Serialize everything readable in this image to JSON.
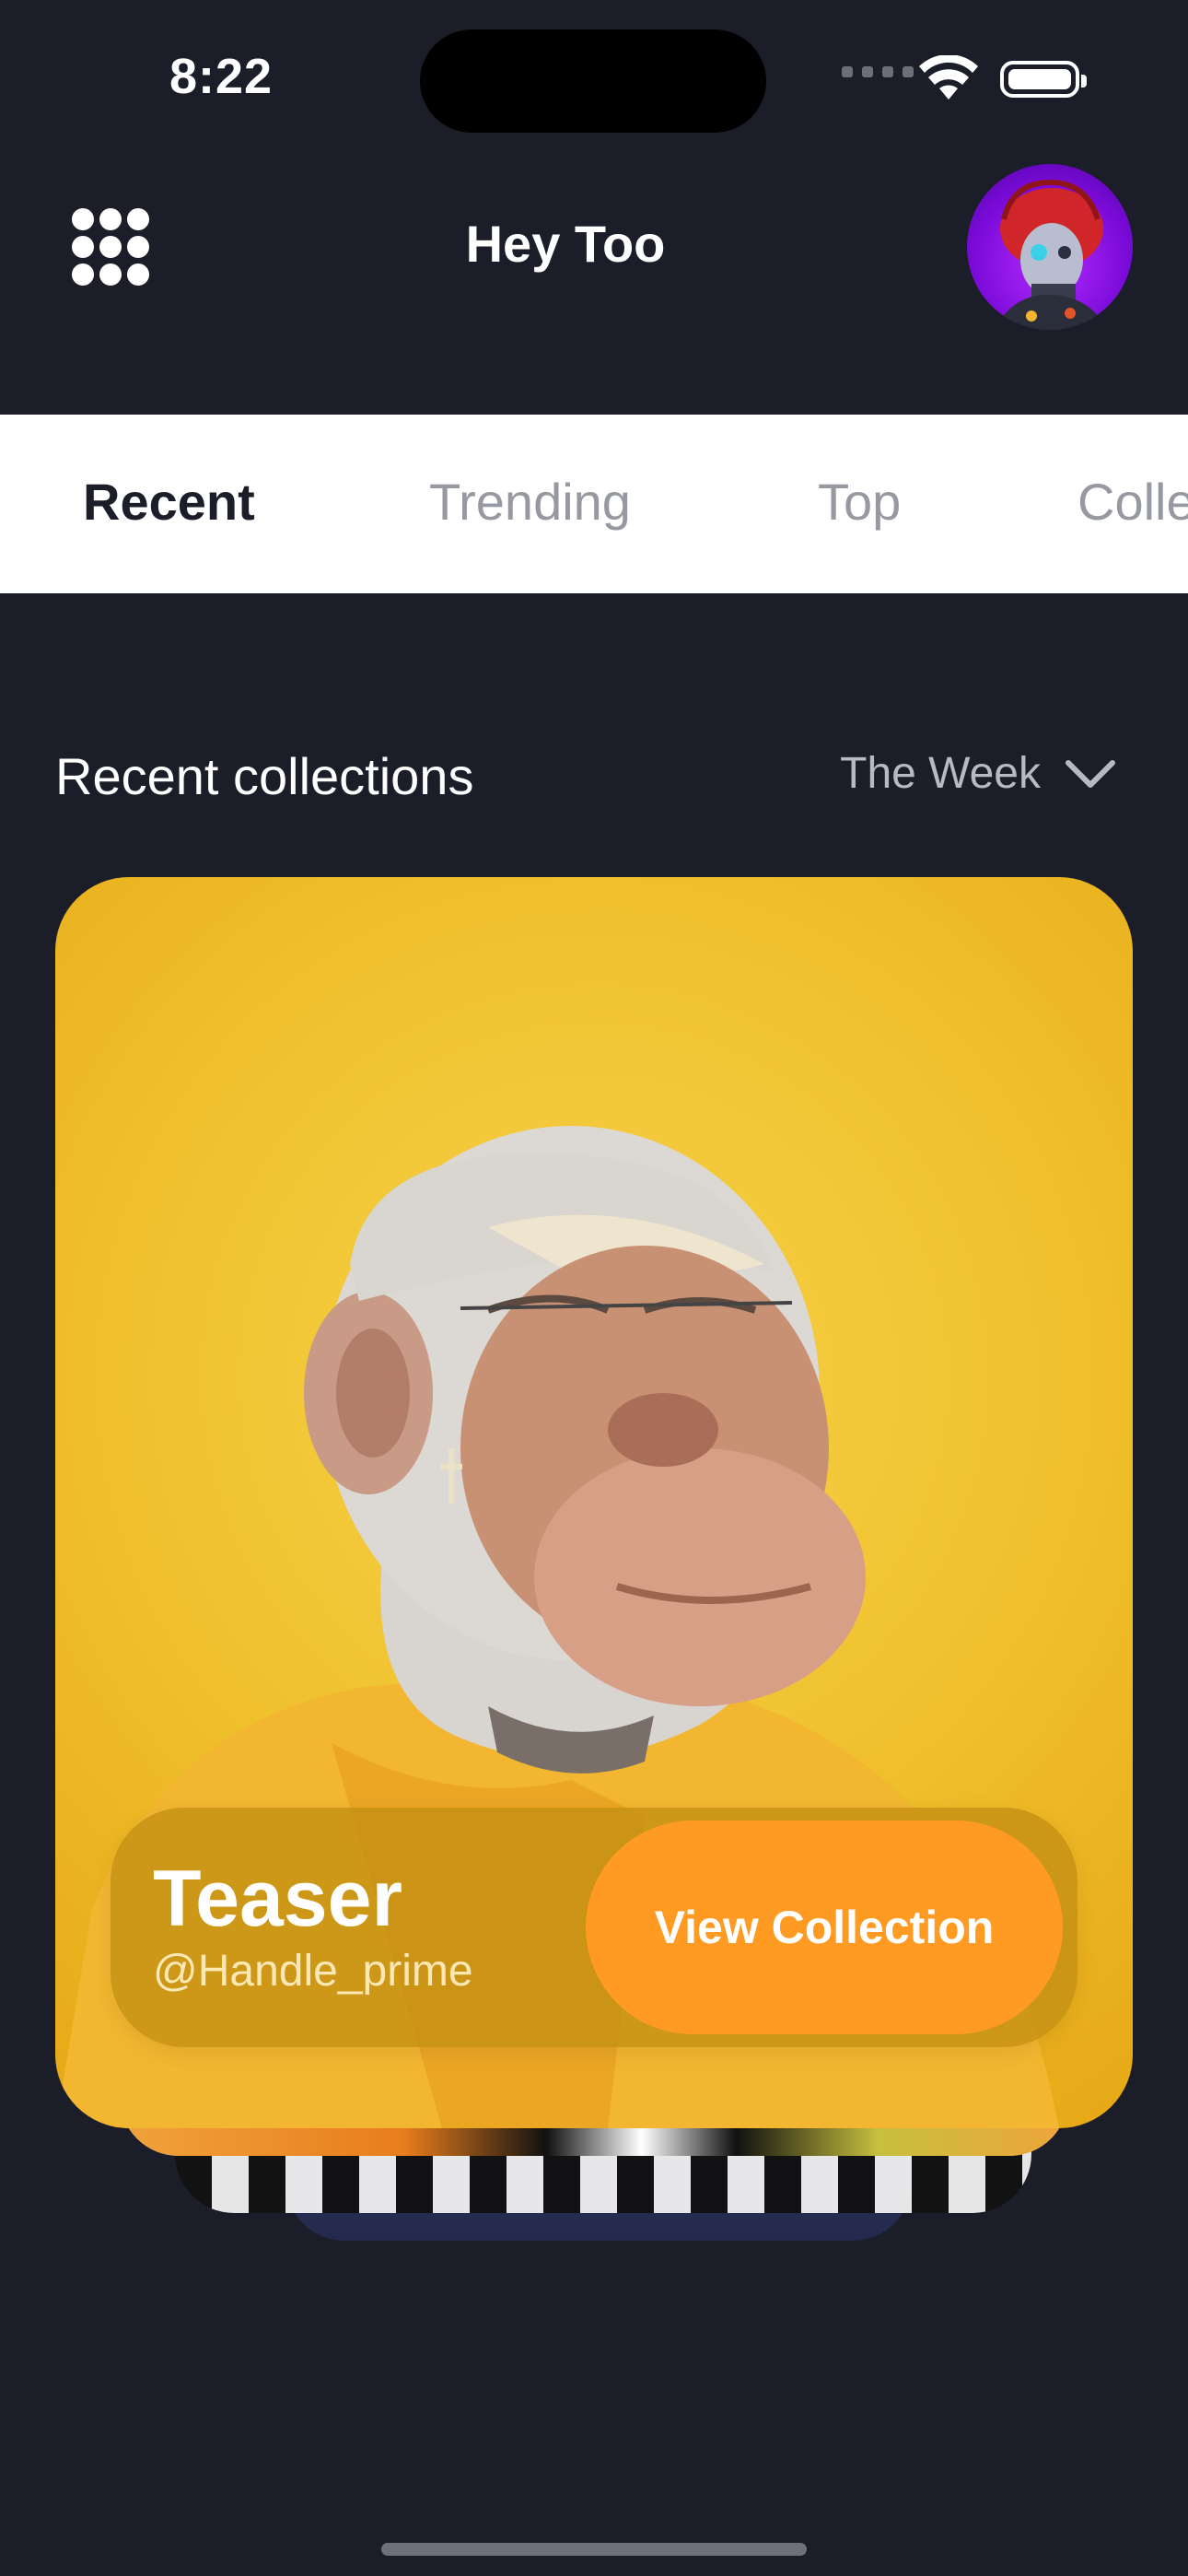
{
  "status_bar": {
    "time": "8:22"
  },
  "header": {
    "title": "Hey Too",
    "menu_icon": "grid-dots-icon",
    "avatar_icon": "avatar-icon"
  },
  "tabs": [
    {
      "label": "Recent",
      "active": true
    },
    {
      "label": "Trending",
      "active": false
    },
    {
      "label": "Top",
      "active": false
    },
    {
      "label": "Colle",
      "active": false
    }
  ],
  "section": {
    "title": "Recent collections",
    "filter_label": "The Week",
    "filter_icon": "chevron-down-icon"
  },
  "card": {
    "title": "Teaser",
    "handle": "@Handle_prime",
    "button_label": "View Collection"
  },
  "colors": {
    "background": "#1b1d29",
    "accent": "#ff9a23",
    "card_bg": "#efbf2b",
    "avatar_bg": "#7a0ad8"
  }
}
